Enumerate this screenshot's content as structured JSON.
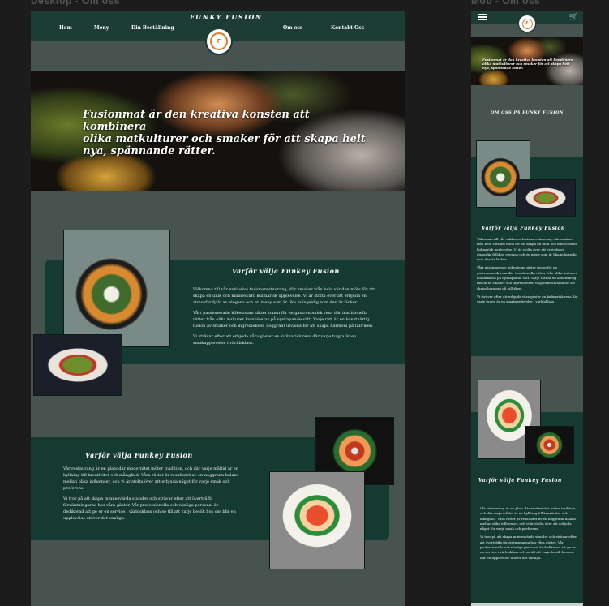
{
  "frames": {
    "desktop_label": "Desktop - Om oss",
    "mobile_label": "Mob - Om oss"
  },
  "brand": {
    "name": "FUNKY FUSION",
    "logo_letter": "F",
    "accent": "#e07a2c",
    "dark_green": "#153a32",
    "nav_green": "#1d3c36",
    "page_grey": "#47534f"
  },
  "nav": {
    "home": "Hem",
    "menu": "Meny",
    "order": "Din Beställning",
    "about": "Om oss",
    "contact": "Kontakt Oss"
  },
  "hero": {
    "line1": "Fusionmat är den kreativa konsten att kombinera",
    "line2": "olika matkulturer och smaker för att skapa helt",
    "line3": "nya, spännande rätter."
  },
  "section1": {
    "title": "Varför välja Funkey Fusion",
    "p1": "Välkomna till vår exklusiva fusionsrestaurang, där smaker från hela världen möts för att skapa en unik och minnesvärd kulinarisk upplevelse. Vi är stolta över att erbjuda en atmosfär fylld av elegans och en meny som är lika mångsidig som den är läcker.",
    "p2": "Vårt passionerade kökesteam sätter tonen för en gastronomisk resa där traditionella rätter från olika kulturer kombineras på nyskapande sätt. Varje rätt är en konstnärlig fusion av smaker och ingredienser, noggrant utvalda för att skapa harmoni på tallriken.",
    "p3": "Vi strävar efter att erbjuda våra gäster en kulinarisk resa där varje tugga är en smakupplevelse i världsklass."
  },
  "section2": {
    "title": "Varför välja Funkey Fusion",
    "p1": "Vår restaurang är en plats där modernitet möter tradition, och där varje måltid är en hyllning till kreativitet och mångfald. Våra rätter är resultatet av en noggrann balans mellan olika influenser, och vi är stolta över att erbjuda något för varje smak och preferens.",
    "p2": "Vi tror på att skapa minnesvärda stunder och strävar efter att överträffa förväntningarna hos våra gäster. Vår professionella och vänliga personal är dedikerad att ge er en service i världsklass och se till att varje besök hos oss blir en upplevelse utöver det vanliga."
  },
  "mobile": {
    "cart_icon": "cart-icon",
    "about_heading": "OM OSS PÅ FUNKY FUSION",
    "hero_text": "Fusionmat är den kreativa konsten att kombinera olika matkulturer och smaker för att skapa helt nya, spännande rätter."
  }
}
